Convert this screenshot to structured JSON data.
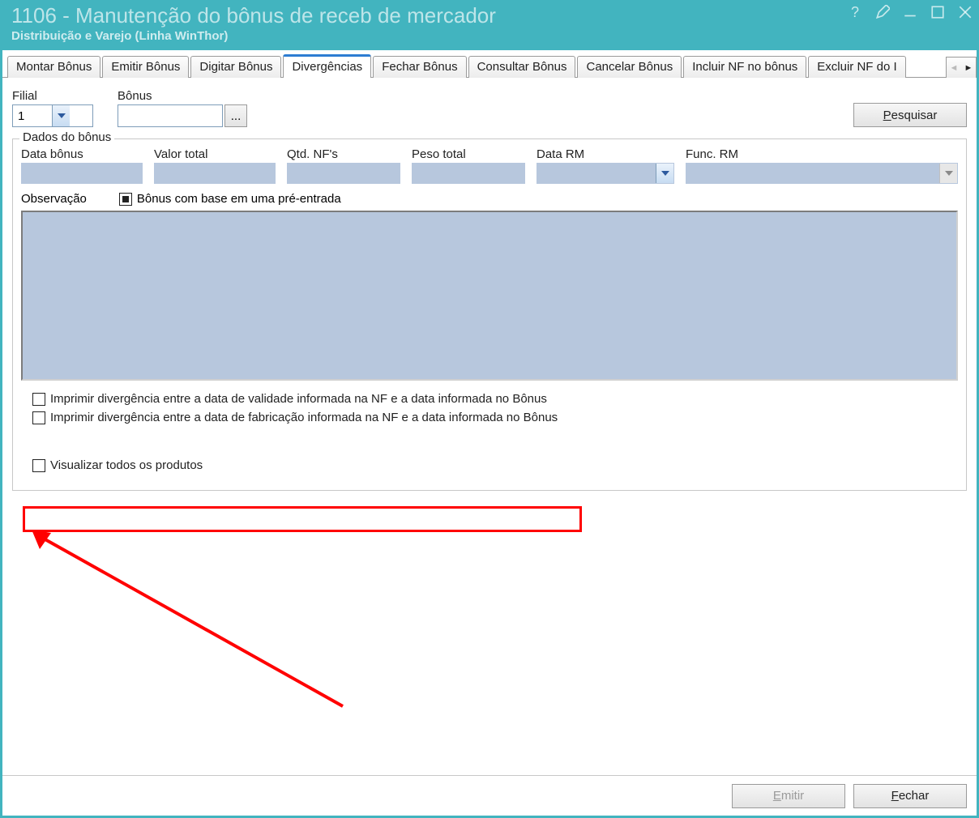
{
  "window": {
    "title": "1106 - Manutenção do bônus de receb de mercador",
    "subtitle": "Distribuição e Varejo (Linha WinThor)"
  },
  "tabs": [
    {
      "label": "Montar Bônus",
      "selected": false
    },
    {
      "label": "Emitir Bônus",
      "selected": false
    },
    {
      "label": "Digitar Bônus",
      "selected": false
    },
    {
      "label": "Divergências",
      "selected": true
    },
    {
      "label": "Fechar Bônus",
      "selected": false
    },
    {
      "label": "Consultar Bônus",
      "selected": false
    },
    {
      "label": "Cancelar Bônus",
      "selected": false
    },
    {
      "label": "Incluir NF no bônus",
      "selected": false
    },
    {
      "label": "Excluir NF do I",
      "selected": false
    }
  ],
  "filters": {
    "filial_label": "Filial",
    "filial_value": "1",
    "bonus_label": "Bônus",
    "bonus_value": "",
    "browse_label": "...",
    "search_label": "Pesquisar",
    "search_mnemonic": "P"
  },
  "dados": {
    "legend": "Dados do bônus",
    "fields": {
      "data_bonus": {
        "label": "Data bônus",
        "value": ""
      },
      "valor_total": {
        "label": "Valor total",
        "value": ""
      },
      "qtd_nfs": {
        "label": "Qtd. NF's",
        "value": ""
      },
      "peso_total": {
        "label": "Peso total",
        "value": ""
      },
      "data_rm": {
        "label": "Data RM",
        "value": ""
      },
      "func_rm": {
        "label": "Func. RM",
        "value": ""
      }
    },
    "observacao_label": "Observação",
    "pre_entrada_label": "Bônus com base em uma pré-entrada",
    "observacao_value": ""
  },
  "checks": {
    "div_validade": "Imprimir divergência entre a data de validade informada na NF e a data informada no Bônus",
    "div_fabricacao": "Imprimir divergência entre a data de fabricação informada na NF e a data informada no Bônus",
    "vis_todos": "Visualizar todos os produtos"
  },
  "footer": {
    "emitir": "Emitir",
    "emitir_mnemonic": "E",
    "fechar": "Fechar",
    "fechar_mnemonic": "F"
  }
}
